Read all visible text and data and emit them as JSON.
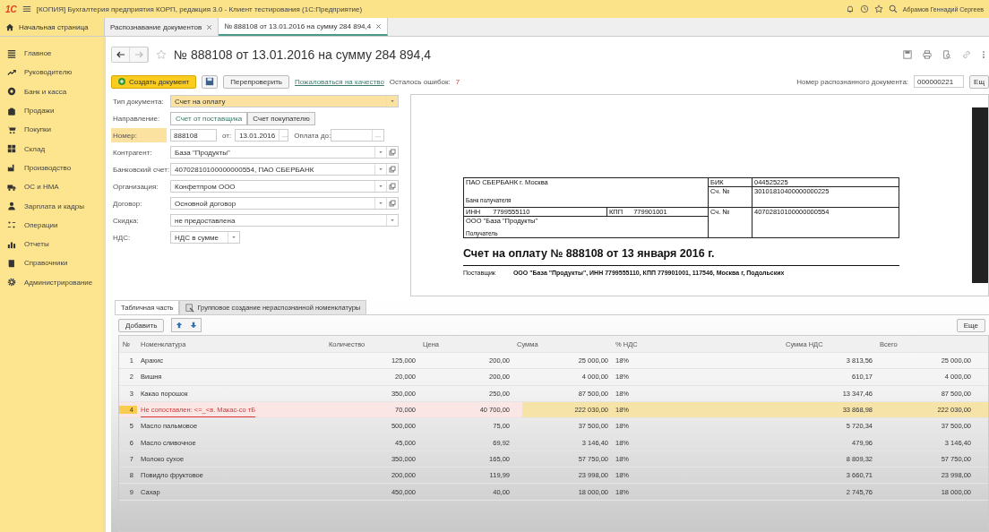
{
  "title_bar": {
    "logo": "1С",
    "title": "[КОПИЯ] Бухгалтерия предприятия КОРП, редакция 3.0  - Клиент тестирования (1С:Предприятие)",
    "user": "Абрамов Геннадий Сергеев"
  },
  "tabs": [
    {
      "label": "Начальная страница",
      "kind": "home",
      "selected": false
    },
    {
      "label": "Распознавание документов",
      "kind": "doc",
      "selected": false
    },
    {
      "label": "№ 888108 от 13.01.2016 на сумму 284 894,4",
      "kind": "doc",
      "selected": true
    }
  ],
  "sidebar": {
    "items": [
      {
        "label": "Главное",
        "kind": "list"
      },
      {
        "label": "Руководителю",
        "kind": "trend"
      },
      {
        "label": "Банк и касса",
        "kind": "coin"
      },
      {
        "label": "Продажи",
        "kind": "bag"
      },
      {
        "label": "Покупки",
        "kind": "cart"
      },
      {
        "label": "Склад",
        "kind": "grid"
      },
      {
        "label": "Производство",
        "kind": "factory"
      },
      {
        "label": "ОС и НМА",
        "kind": "truck"
      },
      {
        "label": "Зарплата и кадры",
        "kind": "person"
      },
      {
        "label": "Операции",
        "kind": "ops"
      },
      {
        "label": "Отчеты",
        "kind": "bars"
      },
      {
        "label": "Справочники",
        "kind": "book"
      },
      {
        "label": "Администрирование",
        "kind": "gear"
      }
    ]
  },
  "form": {
    "title": "№ 888108 от 13.01.2016 на сумму 284 894,4",
    "toolbar": {
      "create_button": "Создать документ",
      "recheck_button": "Перепроверить",
      "complaint_link": "Пожаловаться на качество",
      "errors_label": "Осталось ошибок:",
      "errors_count": "7",
      "recognized_label": "Номер распознанного документа:",
      "recognized_value": "000000221",
      "more_button": "Ещ"
    },
    "fields": [
      {
        "kind": "select",
        "label": "Тип документа:",
        "value": "Счет на оплату",
        "highlighted": true
      },
      {
        "kind": "toggle",
        "label": "Направление:",
        "options": [
          {
            "label": "Счет от поставщика",
            "selected": true
          },
          {
            "label": "Счет покупателю",
            "selected": false
          }
        ]
      },
      {
        "kind": "number",
        "label": "Номер:",
        "value": "888108",
        "highlighted": true,
        "date_label": "от:",
        "date": "13.01.2016",
        "due_label": "Оплата до:"
      },
      {
        "kind": "ref",
        "label": "Контрагент:",
        "value": "База \"Продукты\""
      },
      {
        "kind": "ref",
        "label": "Банковский счет:",
        "value": "40702810100000000554, ПАО СБЕРБАНК"
      },
      {
        "kind": "ref",
        "label": "Организация:",
        "value": "Конфетпром ООО"
      },
      {
        "kind": "ref",
        "label": "Договор:",
        "value": "Основной договор"
      },
      {
        "kind": "select",
        "label": "Скидка:",
        "value": "не предоставлена",
        "highlighted": false
      },
      {
        "kind": "small_select",
        "label": "НДС:",
        "value": "НДС в сумме"
      }
    ]
  },
  "document": {
    "bank": "ПАО СБЕРБАНК г. Москва",
    "bank_caption": "Банк получателя",
    "inn_label": "ИНН",
    "inn": "7799555110",
    "kpp_label": "КПП",
    "kpp": "779901001",
    "recipient": "ООО \"База \"Продукты\"",
    "recipient_caption": "Получатель",
    "bik_label": "БИК",
    "bik": "044525225",
    "corr_label": "Сч. №",
    "corr_account": "30101810400000000225",
    "account_label": "Сч. №",
    "account": "40702810100000000554",
    "heading": "Счет на оплату № 888108 от 13 января 2016 г.",
    "supplier_label": "Поставщик",
    "supplier": "ООО \"База \"Продукты\", ИНН 7799555110, КПП 779901001, 117546, Москва г, Подольских"
  },
  "table_section": {
    "tabs": [
      {
        "label": "Табличная часть",
        "selected": true
      },
      {
        "label": "Групповое создание нераспознанной номенклатуры",
        "selected": false
      }
    ],
    "add_button": "Добавить",
    "more_button": "Еще",
    "columns": [
      "№",
      "Номенклатура",
      "Количество",
      "Цена",
      "Сумма",
      "% НДС",
      "Сумма НДС",
      "Всего"
    ],
    "rows": [
      {
        "n": "1",
        "name": "Арахис",
        "qty": "125,000",
        "price": "200,00",
        "sum": "25 000,00",
        "vat_rate": "18%",
        "vat_sum": "3 813,56",
        "total": "25 000,00",
        "selected": false,
        "error": false
      },
      {
        "n": "2",
        "name": "Вишня",
        "qty": "20,000",
        "price": "200,00",
        "sum": "4 000,00",
        "vat_rate": "18%",
        "vat_sum": "610,17",
        "total": "4 000,00",
        "selected": false,
        "error": false
      },
      {
        "n": "3",
        "name": "Какао порошок",
        "qty": "350,000",
        "price": "250,00",
        "sum": "87 500,00",
        "vat_rate": "18%",
        "vat_sum": "13 347,46",
        "total": "87 500,00",
        "selected": false,
        "error": false
      },
      {
        "n": "4",
        "name": "Не сопоставлен: <=_<в. Макас-со тБ",
        "qty": "70,000",
        "price": "40 700,00",
        "sum": "222 030,00",
        "vat_rate": "18%",
        "vat_sum": "33 868,98",
        "total": "222 030,00",
        "selected": true,
        "error": true
      },
      {
        "n": "5",
        "name": "Масло пальмовое",
        "qty": "500,000",
        "price": "75,00",
        "sum": "37 500,00",
        "vat_rate": "18%",
        "vat_sum": "5 720,34",
        "total": "37 500,00",
        "selected": false,
        "error": false
      },
      {
        "n": "6",
        "name": "Масло сливочное",
        "qty": "45,000",
        "price": "69,92",
        "sum": "3 146,40",
        "vat_rate": "18%",
        "vat_sum": "479,96",
        "total": "3 146,40",
        "selected": false,
        "error": false
      },
      {
        "n": "7",
        "name": "Молоко сухое",
        "qty": "350,000",
        "price": "165,00",
        "sum": "57 750,00",
        "vat_rate": "18%",
        "vat_sum": "8 809,32",
        "total": "57 750,00",
        "selected": false,
        "error": false
      },
      {
        "n": "8",
        "name": "Повидло фруктовое",
        "qty": "200,000",
        "price": "119,99",
        "sum": "23 998,00",
        "vat_rate": "18%",
        "vat_sum": "3 660,71",
        "total": "23 998,00",
        "selected": false,
        "error": false
      },
      {
        "n": "9",
        "name": "Сахар",
        "qty": "450,000",
        "price": "40,00",
        "sum": "18 000,00",
        "vat_rate": "18%",
        "vat_sum": "2 745,76",
        "total": "18 000,00",
        "selected": false,
        "error": false
      }
    ]
  }
}
